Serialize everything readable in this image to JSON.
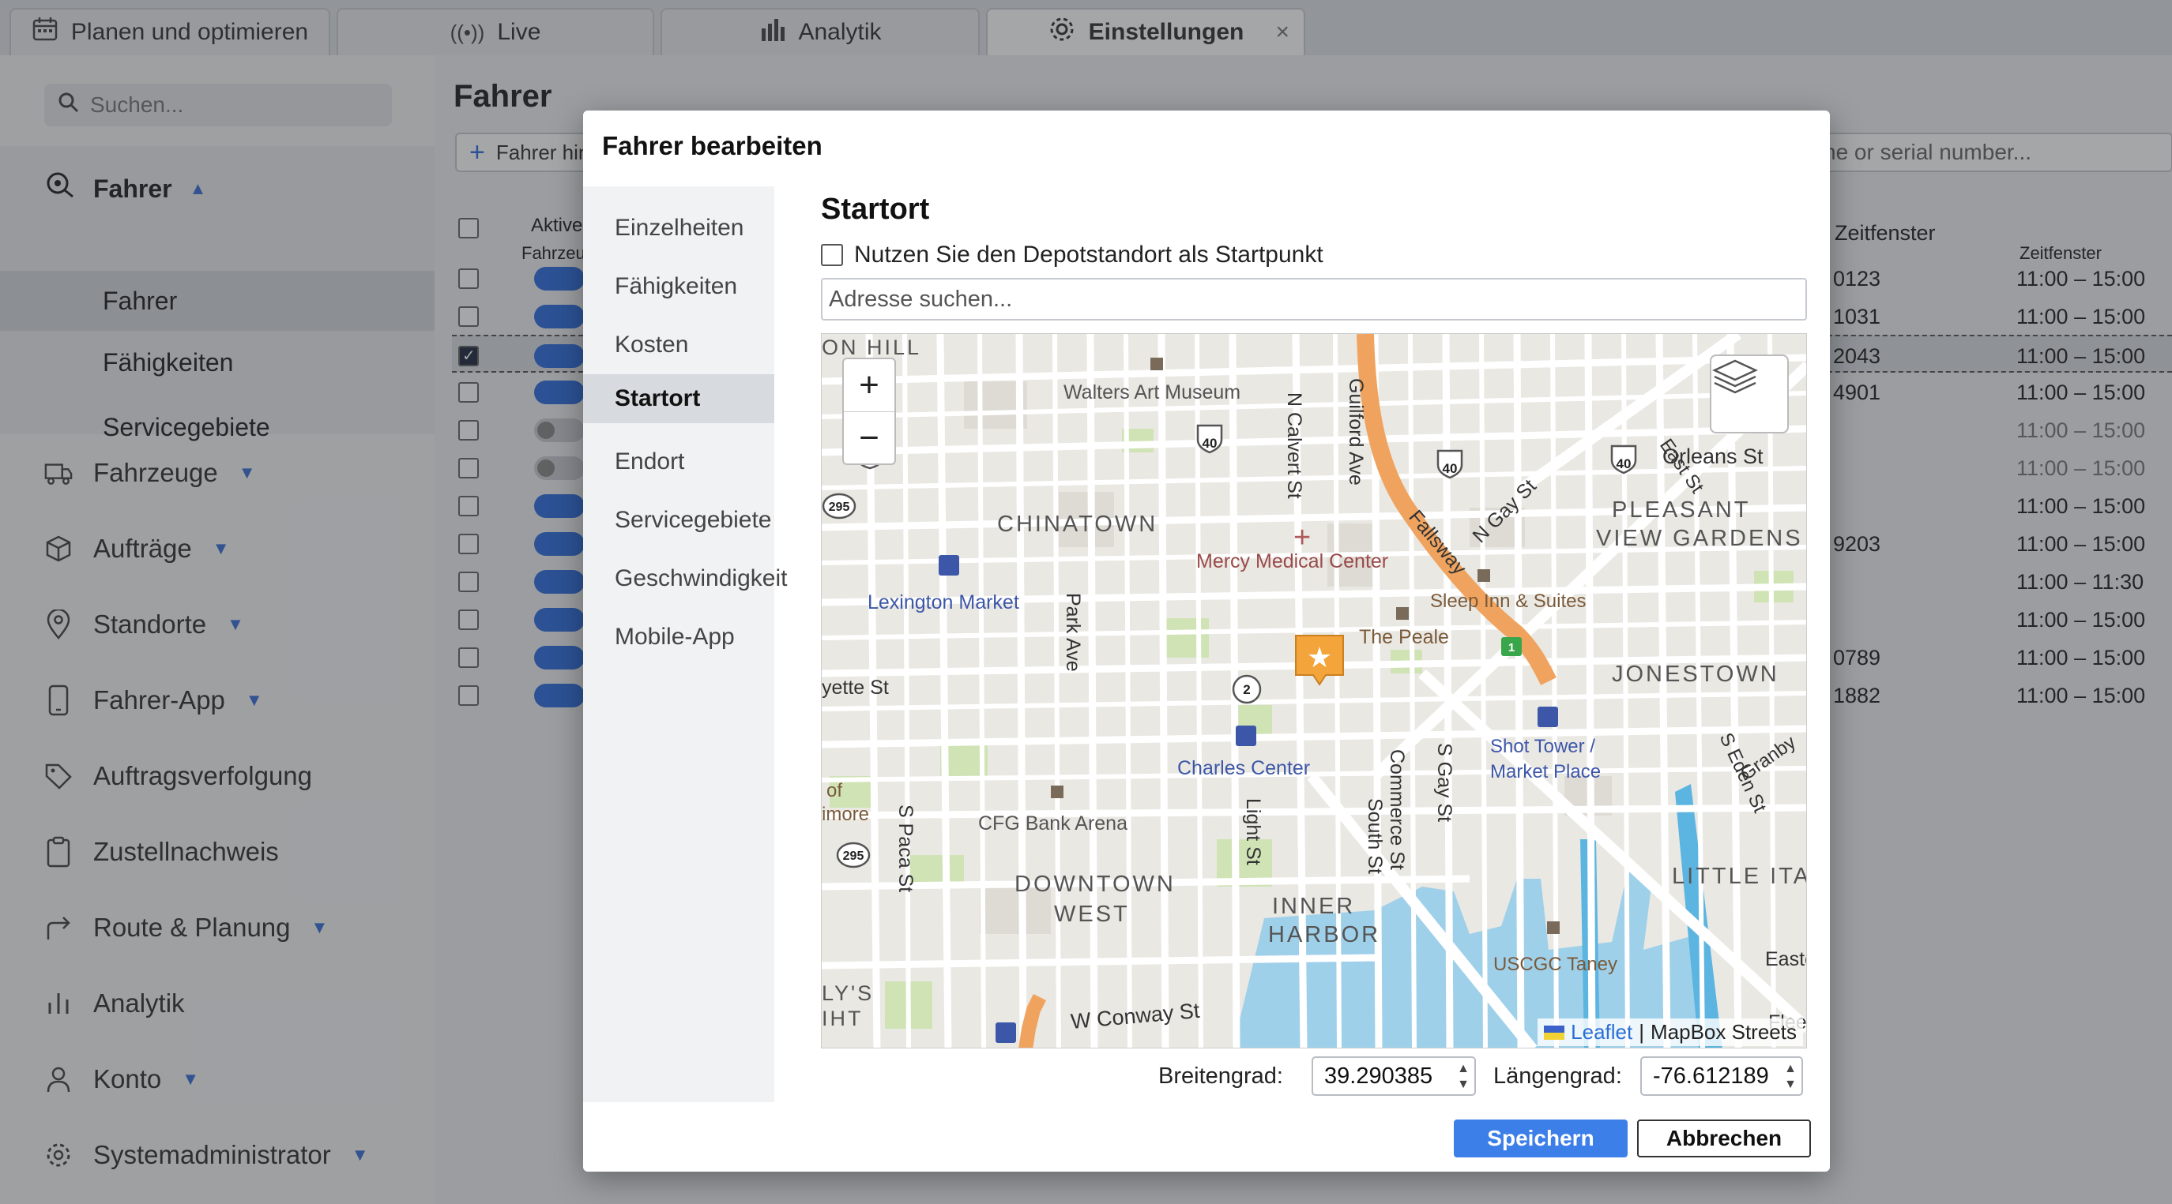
{
  "tabs": [
    {
      "label": "Planen und optimieren",
      "icon": "calendar-icon"
    },
    {
      "label": "Live",
      "icon": "broadcast-icon"
    },
    {
      "label": "Analytik",
      "icon": "bar-chart-icon"
    },
    {
      "label": "Einstellungen",
      "icon": "gear-icon",
      "close": "×"
    }
  ],
  "sidebar": {
    "search_placeholder": "Suchen...",
    "drivers_header": "Fahrer",
    "sub_items": [
      "Fahrer",
      "Fähigkeiten",
      "Servicegebiete"
    ],
    "nav": [
      "Fahrzeuge",
      "Aufträge",
      "Standorte",
      "Fahrer-App",
      "Auftragsverfolgung",
      "Zustellnachweis",
      "Route & Planung",
      "Analytik",
      "Konto",
      "Systemadministrator"
    ]
  },
  "main": {
    "title": "Fahrer",
    "add_button": "Fahrer hin",
    "search_placeholder": "ne or serial number...",
    "col_active": "Aktive",
    "col_active2": "Fahrzeu",
    "col_window": "Zeitfenster",
    "col_window2": "Zeitfenster",
    "rows": [
      {
        "id": "0123",
        "window": "11:00 – 15:00",
        "checked": false,
        "on": true
      },
      {
        "id": "1031",
        "window": "11:00 – 15:00",
        "checked": false,
        "on": true
      },
      {
        "id": "2043",
        "window": "11:00 – 15:00",
        "checked": true,
        "on": true
      },
      {
        "id": "4901",
        "window": "11:00 – 15:00",
        "checked": false,
        "on": true
      },
      {
        "id": "",
        "window": "11:00 – 15:00",
        "checked": false,
        "on": false
      },
      {
        "id": "",
        "window": "11:00 – 15:00",
        "checked": false,
        "on": false
      },
      {
        "id": "",
        "window": "11:00 – 15:00",
        "checked": false,
        "on": true
      },
      {
        "id": "9203",
        "window": "11:00 – 15:00",
        "checked": false,
        "on": true
      },
      {
        "id": "",
        "window": "11:00 – 11:30",
        "checked": false,
        "on": true
      },
      {
        "id": "",
        "window": "11:00 – 15:00",
        "checked": false,
        "on": true
      },
      {
        "id": "0789",
        "window": "11:00 – 15:00",
        "checked": false,
        "on": true
      },
      {
        "id": "1882",
        "window": "11:00 – 15:00",
        "checked": false,
        "on": true
      }
    ]
  },
  "modal": {
    "title": "Fahrer bearbeiten",
    "nav": [
      "Einzelheiten",
      "Fähigkeiten",
      "Kosten",
      "Startort",
      "Endort",
      "Servicegebiete",
      "Geschwindigkeit",
      "Mobile-App"
    ],
    "selected_nav": "Startort",
    "pane_title": "Startort",
    "depot_checkbox": "Nutzen Sie den Depotstandort als Startpunkt",
    "address_placeholder": "Adresse suchen...",
    "map": {
      "zoom_in": "+",
      "zoom_out": "−",
      "labels": {
        "walters": "Walters Art Museum",
        "chinatown": "CHINATOWN",
        "mercy": "Mercy Medical Center",
        "lexington": "Lexington Market",
        "sleep": "Sleep Inn & Suites",
        "peale": "The Peale",
        "pleasant1": "PLEASANT",
        "pleasant2": "VIEW GARDENS",
        "orleans": "Orleans St",
        "jonestown": "JONESTOWN",
        "charles": "Charles Center",
        "shot1": "Shot Tower /",
        "shot2": "Market Place",
        "cfg": "CFG Bank Arena",
        "downtown1": "DOWNTOWN",
        "downtown2": "WEST",
        "inner1": "INNER",
        "inner2": "HARBOR",
        "littleita": "LITTLE ITA",
        "uscgc": "USCGC Taney",
        "conway": "W Conway St",
        "calvert": "N Calvert St",
        "guilford": "Guilford Ave",
        "fallsway": "Fallsway",
        "ngay": "N Gay St",
        "park": "Park Ave",
        "light": "Light St",
        "southst": "South St",
        "commerce": "Commerce St",
        "sgay": "S Gay St",
        "spaca": "S Paca St",
        "seden": "S Eden St",
        "granby": "Granby",
        "fayette": "yette St",
        "easte": "Easte",
        "fleet": "Fleet",
        "eastst": "East St",
        "onhill": "ON HILL",
        "of": "of",
        "imore": "imore",
        "lys": "LY'S",
        "iht": "IHT",
        "shield40": "40",
        "shield295": "295",
        "circle2": "2",
        "green1": "1"
      },
      "attribution_leaflet": "Leaflet",
      "attribution_sep": "|",
      "attribution_tiles": "MapBox Streets"
    },
    "lat_label": "Breitengrad:",
    "lat_value": "39.290385",
    "lng_label": "Längengrad:",
    "lng_value": "-76.612189",
    "save": "Speichern",
    "cancel": "Abbrechen"
  }
}
